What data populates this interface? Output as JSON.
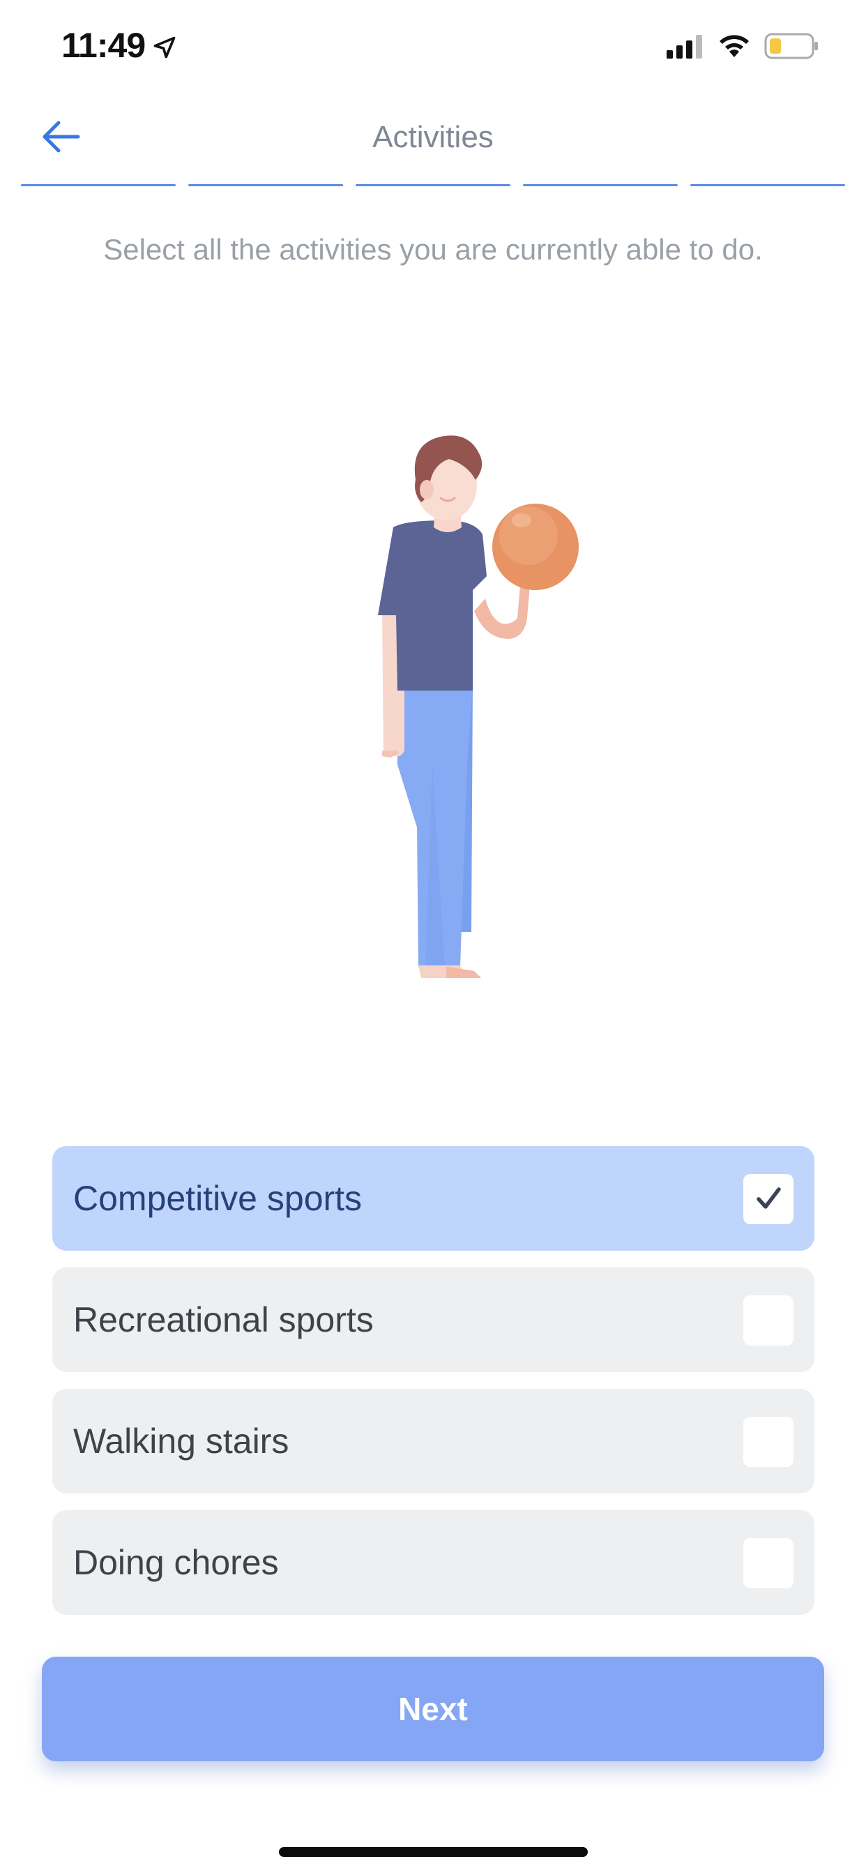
{
  "status_bar": {
    "time": "11:49",
    "location_icon": "location-arrow-icon",
    "signal_icon": "cellular-signal-icon",
    "wifi_icon": "wifi-icon",
    "battery_icon": "battery-low-icon",
    "battery_color": "#f5c842"
  },
  "header": {
    "back_icon": "arrow-left-icon",
    "title": "Activities",
    "progress_steps": 5,
    "accent_color": "#5a8be6"
  },
  "instruction": "Select all the activities you are currently able to do.",
  "options": [
    {
      "label": "Competitive sports",
      "checked": true
    },
    {
      "label": "Recreational sports",
      "checked": false
    },
    {
      "label": "Walking stairs",
      "checked": false
    },
    {
      "label": "Doing chores",
      "checked": false
    }
  ],
  "next_button": {
    "label": "Next",
    "color": "#85a6f4"
  }
}
